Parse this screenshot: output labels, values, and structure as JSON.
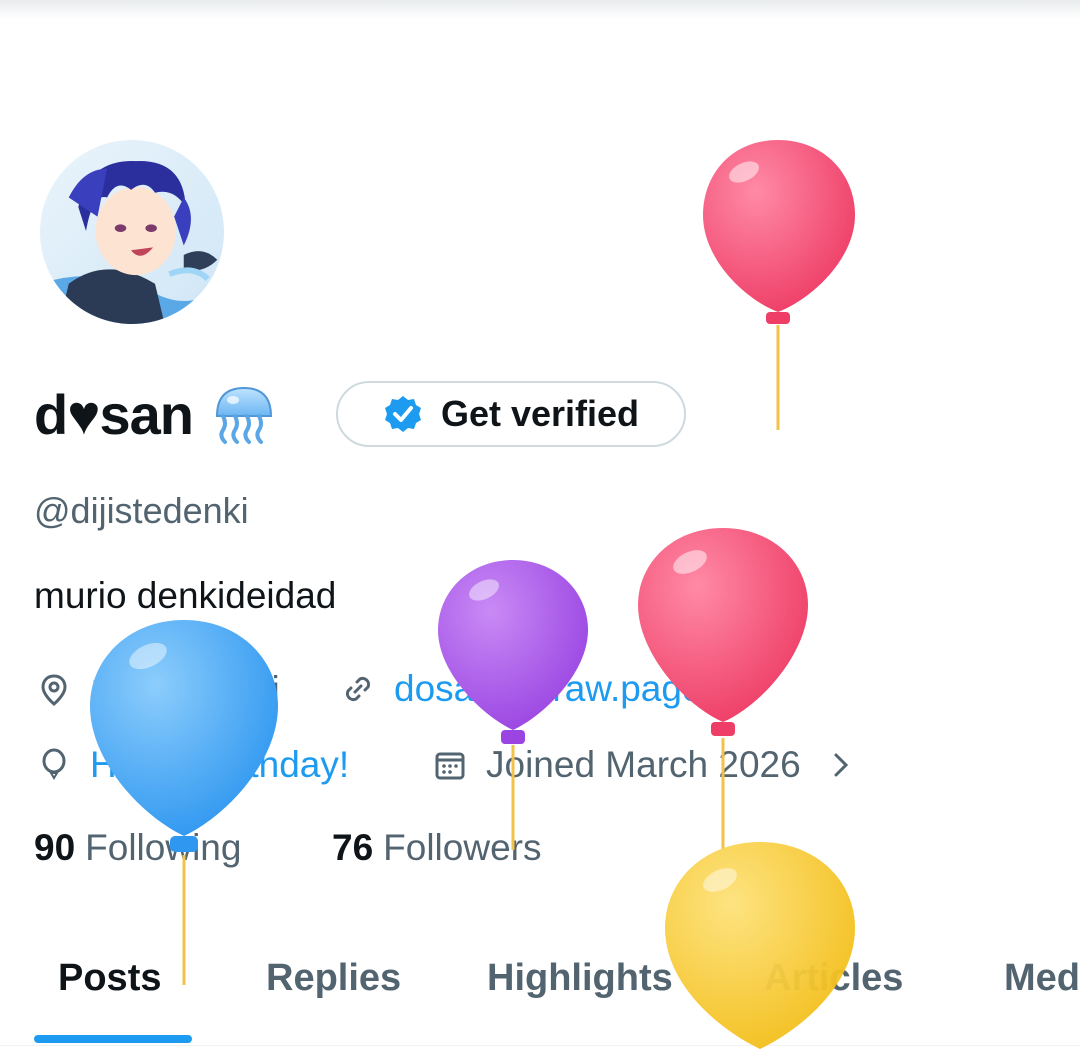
{
  "profile": {
    "display_name": "d♥san",
    "name_emoji_icon": "jellyfish-icon",
    "verify_button_label": "Get verified",
    "handle": "@dijistedenki",
    "bio": "murio denkideidad"
  },
  "meta": {
    "location": "19he ⋆ wini",
    "website": "dosaito.straw.page",
    "birthday": "Happy birthday!",
    "joined": "Joined March 2026"
  },
  "stats": {
    "following_count": "90",
    "following_label": "Following",
    "followers_count": "76",
    "followers_label": "Followers"
  },
  "tabs": [
    {
      "label": "Posts",
      "active": true
    },
    {
      "label": "Replies",
      "active": false
    },
    {
      "label": "Highlights",
      "active": false
    },
    {
      "label": "Articles",
      "active": false
    },
    {
      "label": "Med",
      "active": false
    }
  ],
  "colors": {
    "accent": "#1d9bf0",
    "secondary_text": "#536471",
    "balloon_red": "#f0476d",
    "balloon_purple": "#a04ee6",
    "balloon_blue": "#3da4f5",
    "balloon_yellow": "#f5c72a"
  }
}
